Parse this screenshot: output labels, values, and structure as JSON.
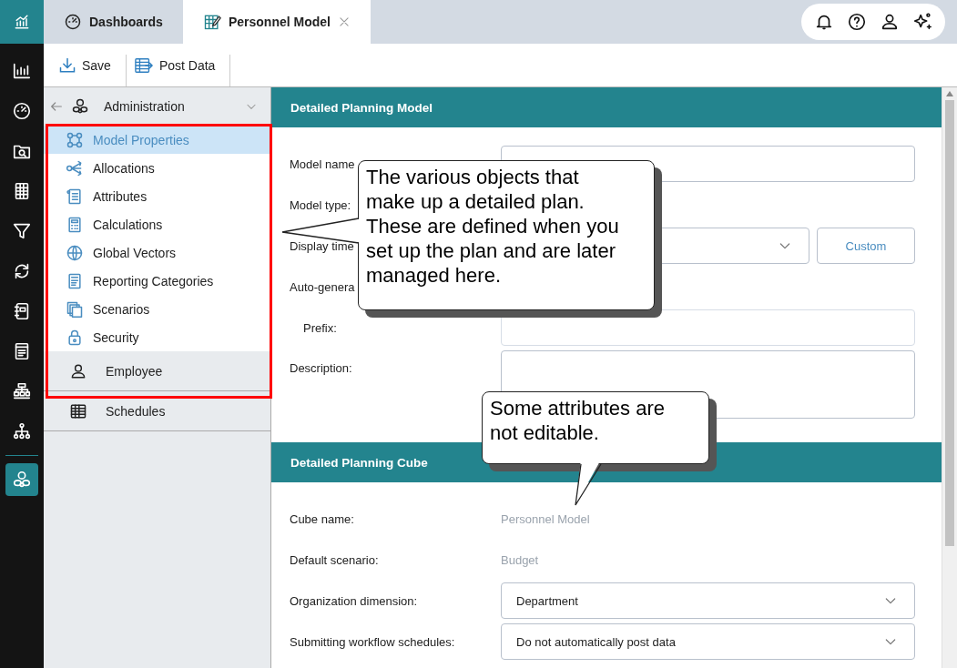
{
  "rail": {
    "items": [
      {
        "selected": false
      },
      {
        "selected": false
      },
      {
        "selected": false
      },
      {
        "selected": false
      },
      {
        "selected": false
      },
      {
        "selected": false
      },
      {
        "selected": false
      },
      {
        "selected": false
      },
      {
        "selected": false
      },
      {
        "selected": false
      },
      {
        "selected": true
      }
    ]
  },
  "tabs": [
    {
      "label": "Dashboards",
      "selected": false,
      "closable": false
    },
    {
      "label": "Personnel Model",
      "selected": true,
      "closable": true
    }
  ],
  "toolbar": {
    "buttons": [
      "Save",
      "Post Data"
    ]
  },
  "nav": {
    "header": "Administration",
    "items": [
      {
        "label": "Model Properties",
        "selected": true
      },
      {
        "label": "Allocations",
        "selected": false
      },
      {
        "label": "Attributes",
        "selected": false
      },
      {
        "label": "Calculations",
        "selected": false
      },
      {
        "label": "Global Vectors",
        "selected": false
      },
      {
        "label": "Reporting Categories",
        "selected": false
      },
      {
        "label": "Scenarios",
        "selected": false
      },
      {
        "label": "Security",
        "selected": false
      }
    ],
    "groups": [
      {
        "label": "Employee"
      },
      {
        "label": "Schedules"
      }
    ]
  },
  "sections": [
    {
      "title": "Detailed Planning Model",
      "fields": [
        {
          "label": "Model name",
          "kind": "text",
          "indented": false
        },
        {
          "label": "Model type:",
          "kind": "label",
          "indented": false
        },
        {
          "label": "Display time",
          "kind": "select",
          "indented": false,
          "button": "Custom"
        },
        {
          "label": "Auto-genera",
          "kind": "label",
          "indented": false
        },
        {
          "label": "Prefix:",
          "kind": "text",
          "indented": true
        },
        {
          "label": "Description:",
          "kind": "textarea",
          "indented": false
        }
      ]
    },
    {
      "title": "Detailed Planning Cube",
      "fields": [
        {
          "label": "Cube name:",
          "kind": "readonly",
          "indented": false,
          "value": "Personnel Model"
        },
        {
          "label": "Default scenario:",
          "kind": "readonly",
          "indented": false,
          "value": "Budget"
        },
        {
          "label": "Organization dimension:",
          "kind": "select",
          "indented": false,
          "value": "Department"
        },
        {
          "label": "Submitting workflow schedules:",
          "kind": "select",
          "indented": false,
          "value": "Do not automatically post data"
        }
      ]
    }
  ],
  "callouts": [
    {
      "text": "The various objects that make up a detailed plan. These are defined when you set up the plan and are later managed here."
    },
    {
      "text": "Some attributes are not editable."
    }
  ]
}
